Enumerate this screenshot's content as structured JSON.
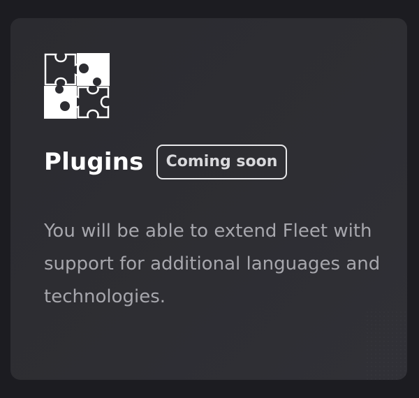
{
  "card": {
    "icon": "puzzle-pieces-icon",
    "title": "Plugins",
    "badge": "Coming soon",
    "description": "You will be able to extend Fleet with support for additional languages and technologies."
  },
  "colors": {
    "page_background": "#1c1c21",
    "card_background": "#2e2e33",
    "title": "#ffffff",
    "badge_border": "#e8e8ea",
    "description": "#a7a7ad"
  }
}
